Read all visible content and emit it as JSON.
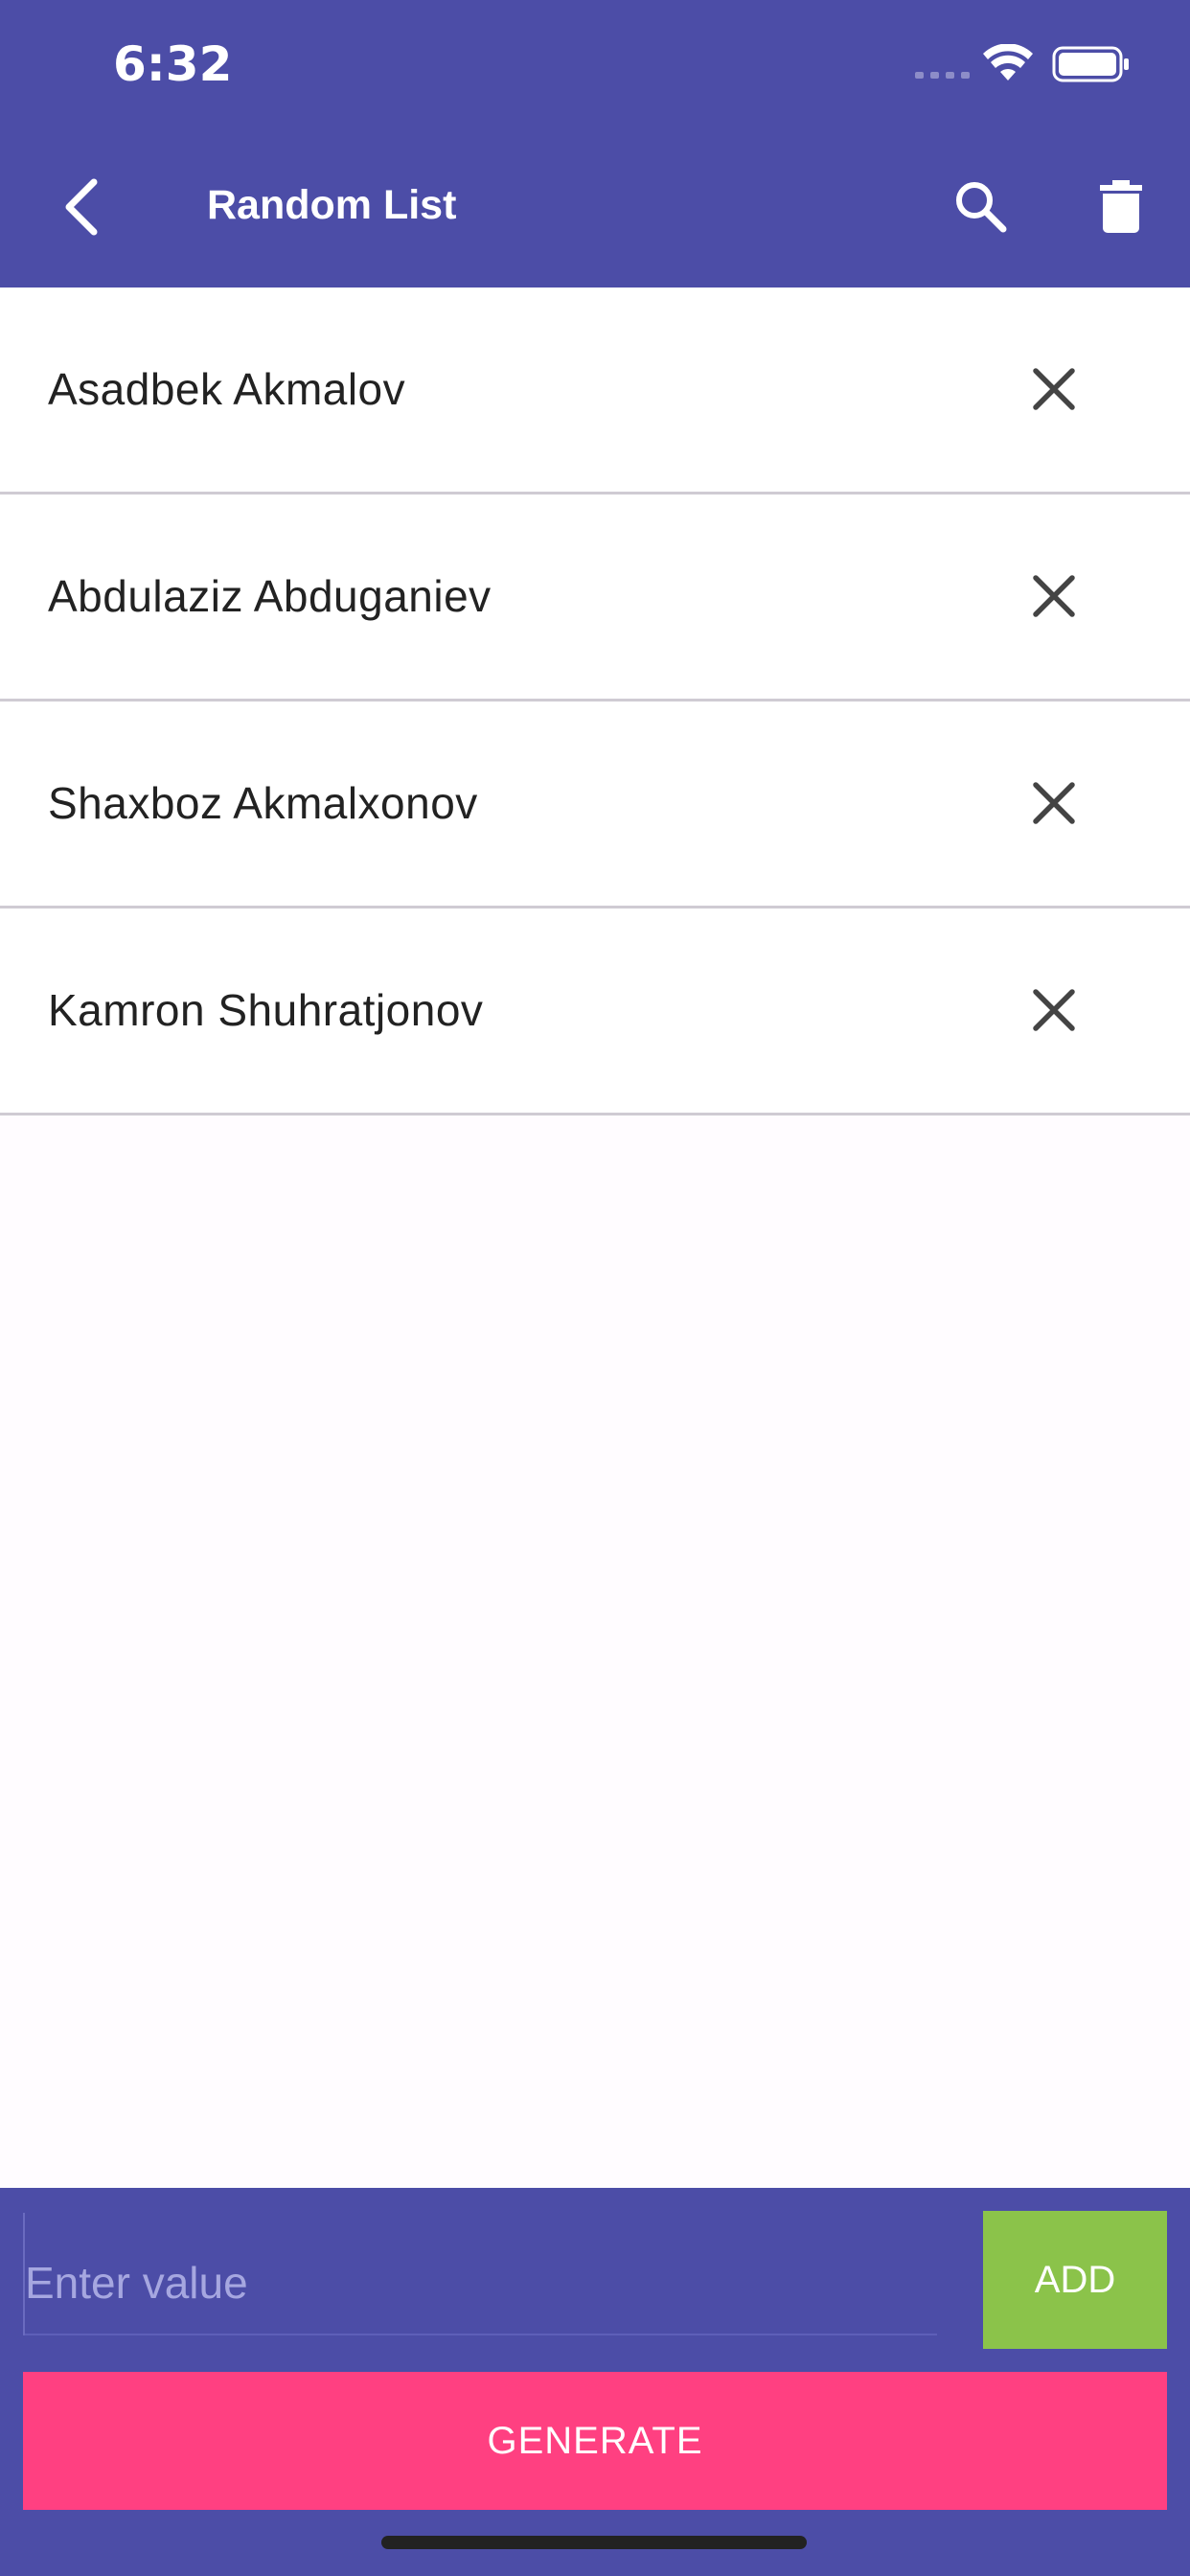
{
  "status_bar": {
    "time": "6:32"
  },
  "app_bar": {
    "title": "Random List",
    "icons": {
      "back": "chevron-left-icon",
      "search": "search-icon",
      "delete_all": "trash-icon"
    }
  },
  "list": {
    "items": [
      {
        "label": "Asadbek Akmalov"
      },
      {
        "label": "Abdulaziz Abduganiev"
      },
      {
        "label": "Shaxboz Akmalxonov"
      },
      {
        "label": "Kamron Shuhratjonov"
      }
    ],
    "remove_icon": "close-icon"
  },
  "input_panel": {
    "placeholder": "Enter value",
    "value": "",
    "add_label": "ADD",
    "generate_label": "GENERATE"
  },
  "colors": {
    "primary": "#4C4DA7",
    "add_button": "#8BC34A",
    "generate_button": "#FF4081",
    "background": "#FFFCFF",
    "divider": "#CFCBD3"
  }
}
